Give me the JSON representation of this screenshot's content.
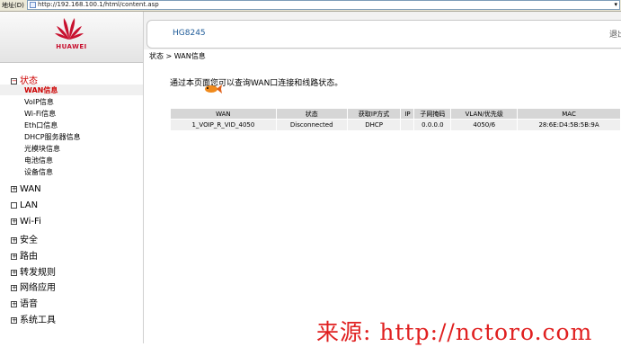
{
  "address_bar": {
    "label": "地址(D)",
    "url": "http://192.168.100.1/html/content.asp"
  },
  "logo": {
    "brand": "HUAWEI"
  },
  "header": {
    "model": "HG8245",
    "logout": "退出"
  },
  "sidebar": {
    "sections": [
      {
        "label": "状态",
        "icon": "minus-box-icon",
        "active": true
      },
      {
        "label": "WAN",
        "icon": "plus-box-icon"
      },
      {
        "label": "LAN",
        "icon": "empty-box-icon"
      },
      {
        "label": "Wi-Fi",
        "icon": "plus-box-icon"
      },
      {
        "label": "安全",
        "icon": "plus-box-icon"
      },
      {
        "label": "路由",
        "icon": "plus-box-icon"
      },
      {
        "label": "转发规则",
        "icon": "plus-box-icon"
      },
      {
        "label": "网络应用",
        "icon": "plus-box-icon"
      },
      {
        "label": "语音",
        "icon": "plus-box-icon"
      },
      {
        "label": "系统工具",
        "icon": "plus-box-icon"
      }
    ],
    "status_items": [
      "WAN信息",
      "VoIP信息",
      "Wi-Fi信息",
      "Eth口信息",
      "DHCP服务器信息",
      "光模块信息",
      "电池信息",
      "设备信息"
    ]
  },
  "breadcrumb": "状态 > WAN信息",
  "intro": "通过本页面您可以查询WAN口连接和线路状态。",
  "table": {
    "headers": [
      "WAN",
      "状态",
      "获取IP方式",
      "IP",
      "子网掩码",
      "VLAN/优先级",
      "MAC"
    ],
    "rows": [
      [
        "1_VOIP_R_VID_4050",
        "Disconnected",
        "DHCP",
        "",
        "0.0.0.0",
        "4050/6",
        "28:6E:D4:5B:5B:9A"
      ]
    ]
  },
  "watermark": "来源: http://nctoro.com",
  "colors": {
    "brand_red": "#c8102e",
    "active_text": "#cc0000",
    "header_blue": "#1f5c99",
    "watermark": "#e02020"
  }
}
